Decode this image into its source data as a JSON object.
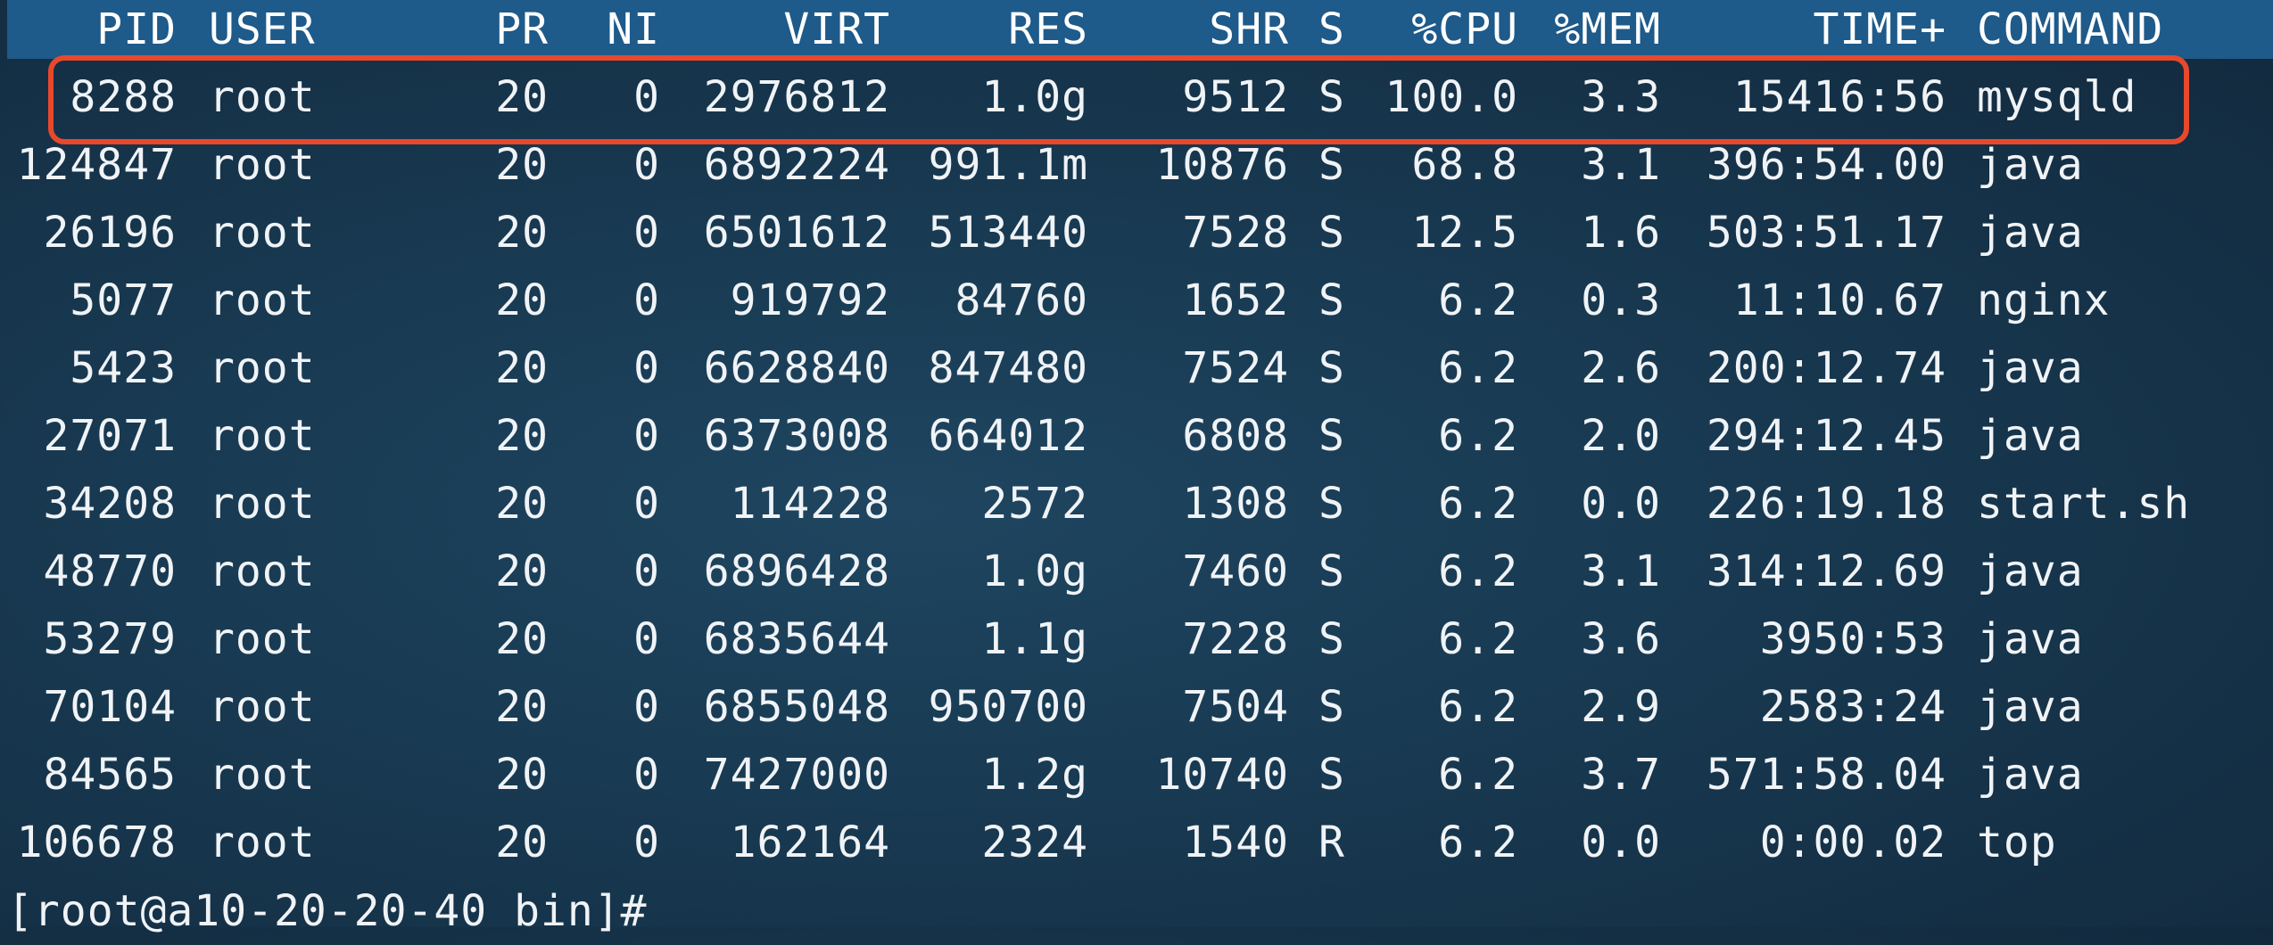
{
  "header": {
    "pid": "PID",
    "user": "USER",
    "pr": "PR",
    "ni": "NI",
    "virt": "VIRT",
    "res": "RES",
    "shr": "SHR",
    "s": "S",
    "cpu": "%CPU",
    "mem": "%MEM",
    "time": "TIME+",
    "command": "COMMAND"
  },
  "processes": [
    {
      "pid": "8288",
      "user": "root",
      "pr": "20",
      "ni": "0",
      "virt": "2976812",
      "res": "1.0g",
      "shr": "9512",
      "s": "S",
      "cpu": "100.0",
      "mem": "3.3",
      "time": "15416:56",
      "command": "mysqld"
    },
    {
      "pid": "124847",
      "user": "root",
      "pr": "20",
      "ni": "0",
      "virt": "6892224",
      "res": "991.1m",
      "shr": "10876",
      "s": "S",
      "cpu": "68.8",
      "mem": "3.1",
      "time": "396:54.00",
      "command": "java"
    },
    {
      "pid": "26196",
      "user": "root",
      "pr": "20",
      "ni": "0",
      "virt": "6501612",
      "res": "513440",
      "shr": "7528",
      "s": "S",
      "cpu": "12.5",
      "mem": "1.6",
      "time": "503:51.17",
      "command": "java"
    },
    {
      "pid": "5077",
      "user": "root",
      "pr": "20",
      "ni": "0",
      "virt": "919792",
      "res": "84760",
      "shr": "1652",
      "s": "S",
      "cpu": "6.2",
      "mem": "0.3",
      "time": "11:10.67",
      "command": "nginx"
    },
    {
      "pid": "5423",
      "user": "root",
      "pr": "20",
      "ni": "0",
      "virt": "6628840",
      "res": "847480",
      "shr": "7524",
      "s": "S",
      "cpu": "6.2",
      "mem": "2.6",
      "time": "200:12.74",
      "command": "java"
    },
    {
      "pid": "27071",
      "user": "root",
      "pr": "20",
      "ni": "0",
      "virt": "6373008",
      "res": "664012",
      "shr": "6808",
      "s": "S",
      "cpu": "6.2",
      "mem": "2.0",
      "time": "294:12.45",
      "command": "java"
    },
    {
      "pid": "34208",
      "user": "root",
      "pr": "20",
      "ni": "0",
      "virt": "114228",
      "res": "2572",
      "shr": "1308",
      "s": "S",
      "cpu": "6.2",
      "mem": "0.0",
      "time": "226:19.18",
      "command": "start.sh"
    },
    {
      "pid": "48770",
      "user": "root",
      "pr": "20",
      "ni": "0",
      "virt": "6896428",
      "res": "1.0g",
      "shr": "7460",
      "s": "S",
      "cpu": "6.2",
      "mem": "3.1",
      "time": "314:12.69",
      "command": "java"
    },
    {
      "pid": "53279",
      "user": "root",
      "pr": "20",
      "ni": "0",
      "virt": "6835644",
      "res": "1.1g",
      "shr": "7228",
      "s": "S",
      "cpu": "6.2",
      "mem": "3.6",
      "time": "3950:53",
      "command": "java"
    },
    {
      "pid": "70104",
      "user": "root",
      "pr": "20",
      "ni": "0",
      "virt": "6855048",
      "res": "950700",
      "shr": "7504",
      "s": "S",
      "cpu": "6.2",
      "mem": "2.9",
      "time": "2583:24",
      "command": "java"
    },
    {
      "pid": "84565",
      "user": "root",
      "pr": "20",
      "ni": "0",
      "virt": "7427000",
      "res": "1.2g",
      "shr": "10740",
      "s": "S",
      "cpu": "6.2",
      "mem": "3.7",
      "time": "571:58.04",
      "command": "java"
    },
    {
      "pid": "106678",
      "user": "root",
      "pr": "20",
      "ni": "0",
      "virt": "162164",
      "res": "2324",
      "shr": "1540",
      "s": "R",
      "cpu": "6.2",
      "mem": "0.0",
      "time": "0:00.02",
      "command": "top"
    }
  ],
  "prompt": "[root@a10-20-20-40 bin]#",
  "colors": {
    "header_bg": "#1e5a8a",
    "highlight_border": "#e8482c",
    "text": "#f0f3f6"
  }
}
